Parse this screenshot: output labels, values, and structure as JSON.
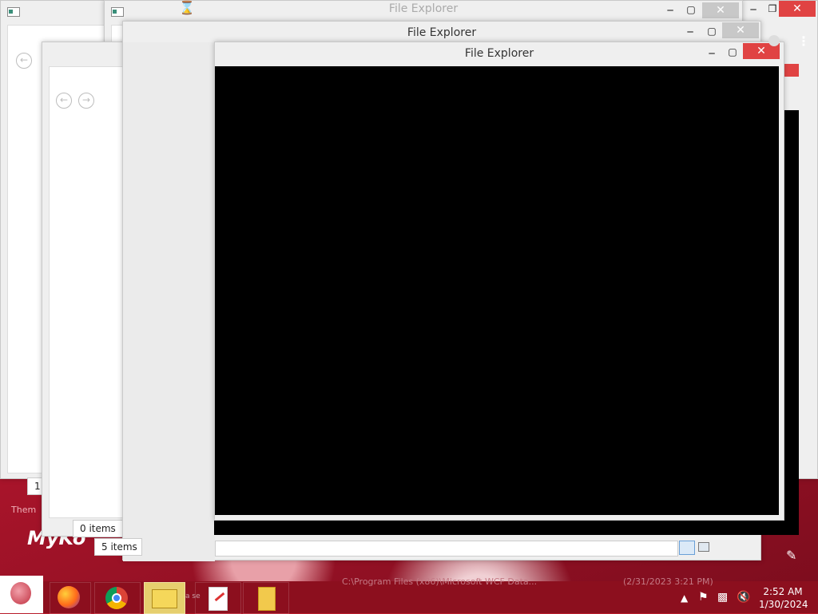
{
  "windows": {
    "back": {
      "title": "File Explorer",
      "status": "1"
    },
    "mid": {
      "title": "File Explorer",
      "status": "0 items"
    },
    "left_status": "5 items",
    "front": {
      "title": "File Explorer"
    }
  },
  "desktop": {
    "left_text": "MyKo",
    "left_faint": "Them"
  },
  "taskbar": {
    "items": [
      "start-orb",
      "firefox",
      "chrome",
      "file-explorer",
      "paint",
      "folder"
    ],
    "background_text": "C:\\Program Files (x86)\\Microsoft WCF Data...",
    "background_date": "(2/31/2023 3:21 PM)"
  },
  "tray": {
    "time": "2:52 AM",
    "date": "1/30/2024"
  },
  "colors": {
    "accent_red": "#e04343",
    "taskbar": "#8c0f1e"
  }
}
